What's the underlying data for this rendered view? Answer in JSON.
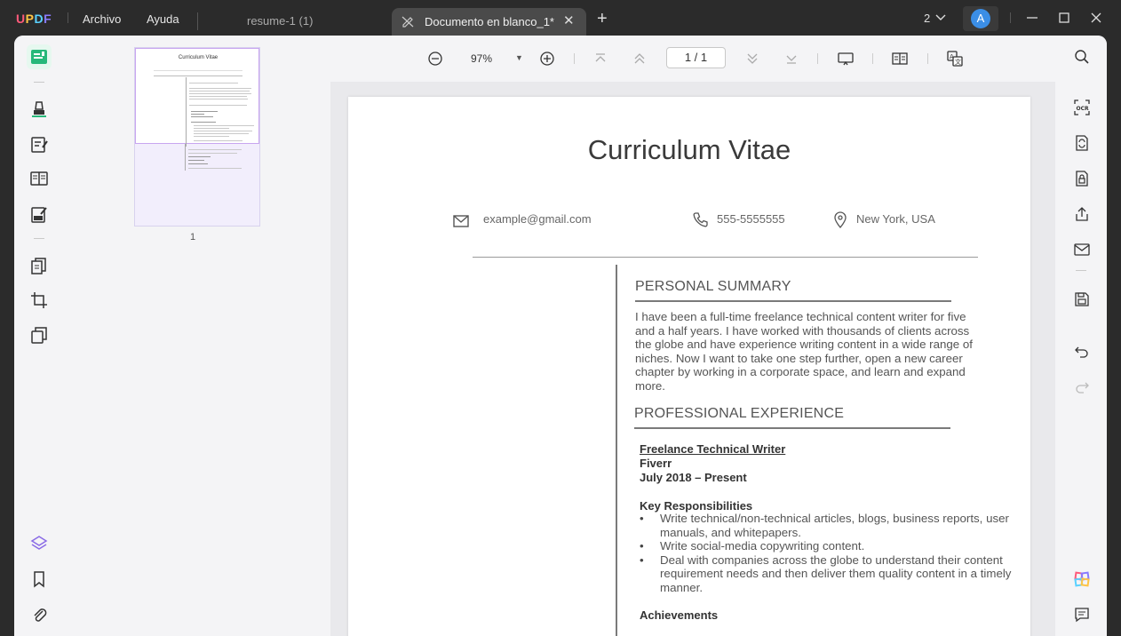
{
  "app": {
    "logo_letters": [
      "U",
      "P",
      "D",
      "F"
    ],
    "menu": [
      "Archivo",
      "Ayuda"
    ]
  },
  "tabs": [
    {
      "label": "resume-1 (1)",
      "active": false
    },
    {
      "label": "Documento en blanco_1*",
      "active": true
    }
  ],
  "window": {
    "page_count": "2",
    "avatar_initial": "A"
  },
  "toolbar": {
    "zoom": "97%",
    "page_indicator": "1  /  1"
  },
  "thumbnail": {
    "page_number": "1",
    "title": "Curriculum Vitae"
  },
  "document": {
    "title": "Curriculum Vitae",
    "email": "example@gmail.com",
    "phone": "555-5555555",
    "location": "New York, USA",
    "summary_heading": "PERSONAL SUMMARY",
    "summary_text": "I have been a full-time freelance technical content writer for five and a half years. I have worked with thousands of clients across the globe and have experience writing content in a wide range of niches. Now I want to take one step further, open a new career chapter by working in a corporate space, and learn and expand more.",
    "experience_heading": "PROFESSIONAL EXPERIENCE",
    "job_title": "Freelance Technical Writer",
    "company": "Fiverr",
    "dates": "July 2018 – Present",
    "responsibilities_heading": "Key Responsibilities",
    "responsibilities": [
      "Write technical/non-technical articles, blogs, business reports, user manuals, and whitepapers.",
      "Write social-media copywriting content.",
      "Deal with companies across the globe to understand their content requirement needs and then deliver them quality content in a timely manner."
    ],
    "achievements_heading": "Achievements"
  },
  "colors": {
    "accent_green": "#27b87a",
    "thumbnail_highlight": "#c8a6f0",
    "avatar_blue": "#3b8ee6"
  }
}
